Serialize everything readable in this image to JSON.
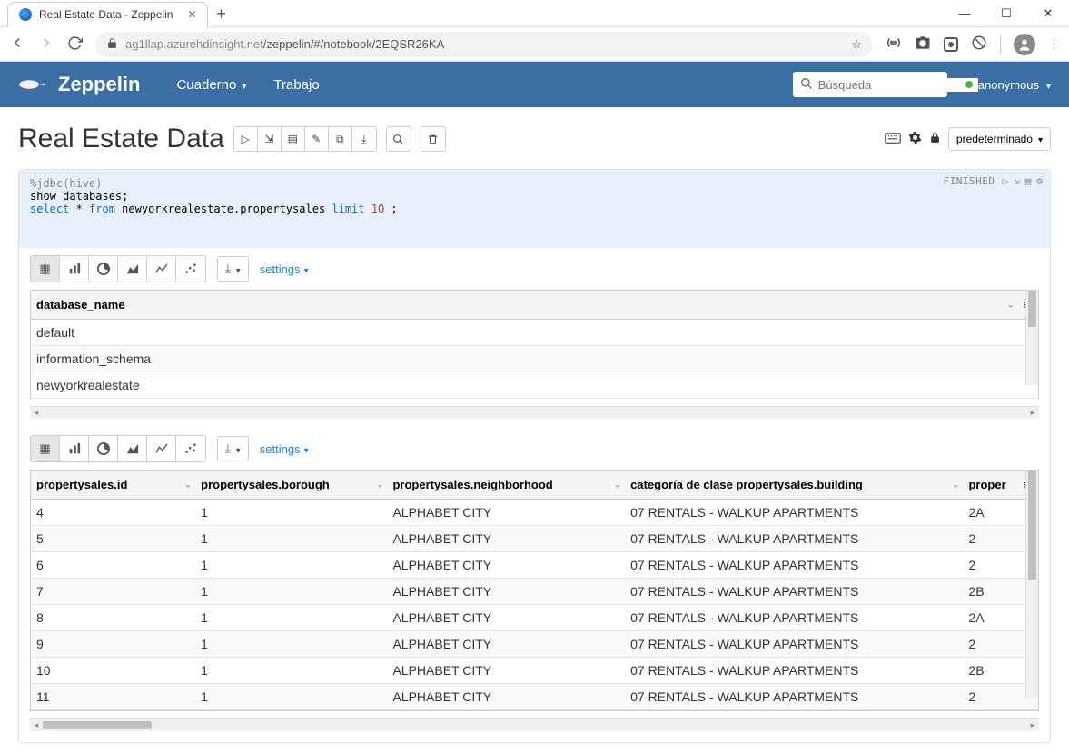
{
  "window": {
    "tab_title": "Real Estate Data - Zeppelin"
  },
  "browser": {
    "url_host": "ag1llap.azurehdinsight.net",
    "url_path": "/zeppelin/#/notebook/2EQSR26KA"
  },
  "zeppelin": {
    "brand": "Zeppelin",
    "menu": {
      "notebook": "Cuaderno",
      "job": "Trabajo"
    },
    "search_placeholder": "Búsqueda",
    "user": "anonymous"
  },
  "notebook": {
    "title": "Real Estate Data",
    "mode_label": "predeterminado"
  },
  "paragraph": {
    "status": "FINISHED",
    "code_line1_prefix": "%jdbc(hive)",
    "code_line2": "show databases;",
    "code_line3_a": "select",
    "code_line3_b": " * ",
    "code_line3_c": "from",
    "code_line3_d": " newyorkrealestate.propertysales ",
    "code_line3_e": "limit",
    "code_line3_f": " 10",
    "code_line3_g": " ;"
  },
  "result1": {
    "settings_label": "settings",
    "header": "database_name",
    "rows": [
      "default",
      "information_schema",
      "newyorkrealestate"
    ]
  },
  "result2": {
    "settings_label": "settings",
    "headers": {
      "id": "propertysales.id",
      "borough": "propertysales.borough",
      "neighborhood": "propertysales.neighborhood",
      "category": "categoría de clase propertysales.building",
      "prop": "proper"
    },
    "rows": [
      {
        "id": "4",
        "borough": "1",
        "neighborhood": "ALPHABET CITY",
        "category": "07 RENTALS - WALKUP APARTMENTS",
        "prop": "2A"
      },
      {
        "id": "5",
        "borough": "1",
        "neighborhood": "ALPHABET CITY",
        "category": "07 RENTALS - WALKUP APARTMENTS",
        "prop": "2"
      },
      {
        "id": "6",
        "borough": "1",
        "neighborhood": "ALPHABET CITY",
        "category": "07 RENTALS - WALKUP APARTMENTS",
        "prop": "2"
      },
      {
        "id": "7",
        "borough": "1",
        "neighborhood": "ALPHABET CITY",
        "category": "07 RENTALS - WALKUP APARTMENTS",
        "prop": "2B"
      },
      {
        "id": "8",
        "borough": "1",
        "neighborhood": "ALPHABET CITY",
        "category": "07 RENTALS - WALKUP APARTMENTS",
        "prop": "2A"
      },
      {
        "id": "9",
        "borough": "1",
        "neighborhood": "ALPHABET CITY",
        "category": "07 RENTALS - WALKUP APARTMENTS",
        "prop": "2"
      },
      {
        "id": "10",
        "borough": "1",
        "neighborhood": "ALPHABET CITY",
        "category": "07 RENTALS - WALKUP APARTMENTS",
        "prop": "2B"
      },
      {
        "id": "11",
        "borough": "1",
        "neighborhood": "ALPHABET CITY",
        "category": "07 RENTALS - WALKUP APARTMENTS",
        "prop": "2"
      }
    ]
  }
}
